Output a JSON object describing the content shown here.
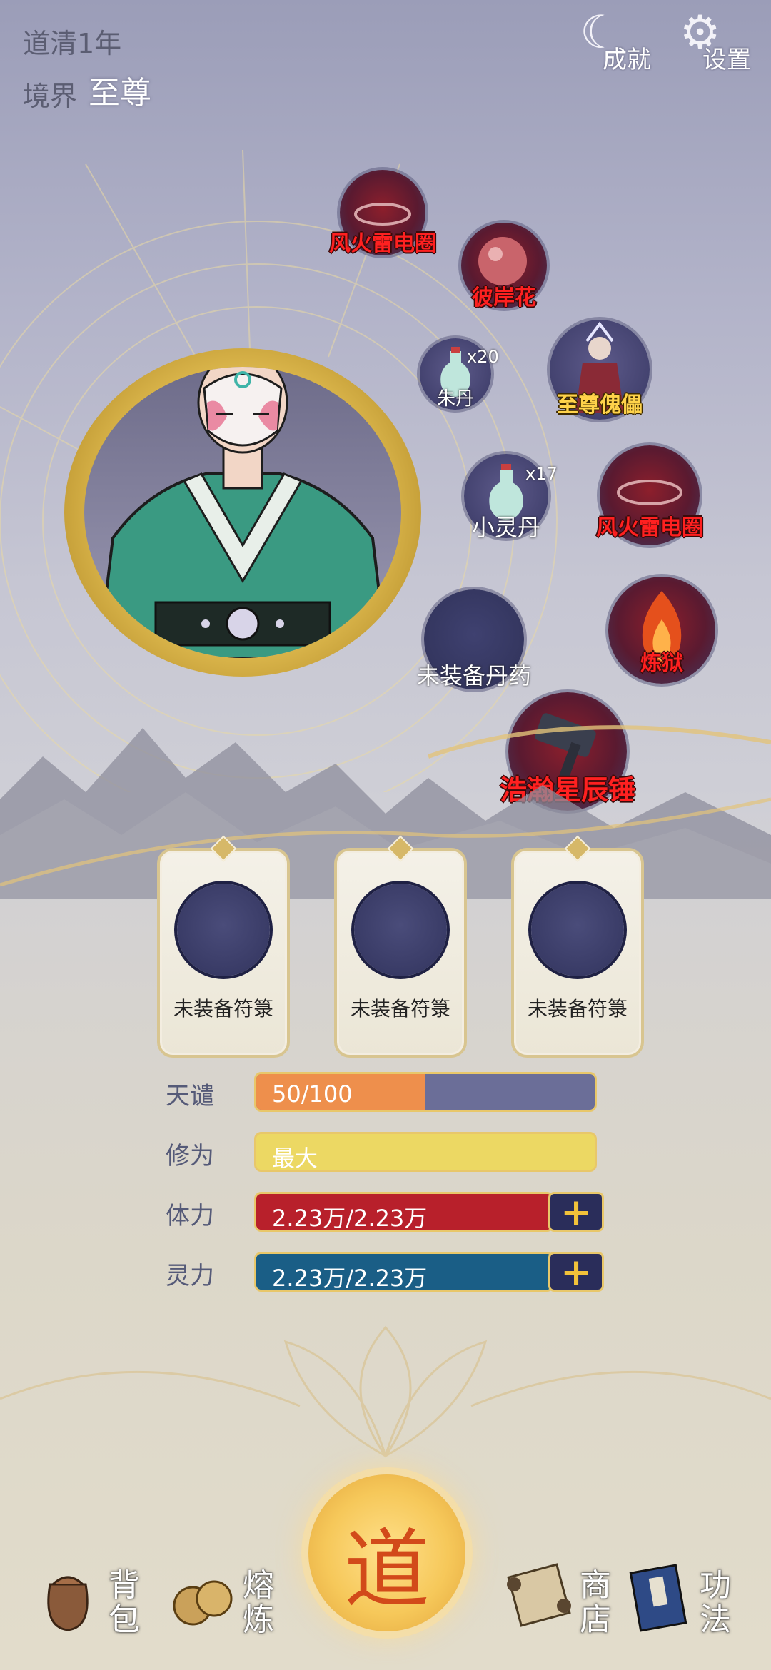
{
  "header": {
    "year": "道清1年",
    "realm_label": "境界",
    "realm_value": "至尊",
    "achievements_label": "成就",
    "settings_label": "设置"
  },
  "equipment": {
    "slots": [
      {
        "label": "风火雷电圈",
        "style": "red"
      },
      {
        "label": "彼岸花",
        "style": "red"
      },
      {
        "label": "朱丹",
        "count": "x20",
        "style": "white"
      },
      {
        "label": "至尊傀儡",
        "style": "gold"
      },
      {
        "label": "小灵丹",
        "count": "x17",
        "style": "white"
      },
      {
        "label": "风火雷电圈",
        "style": "red"
      },
      {
        "label": "未装备丹药",
        "style": "white"
      },
      {
        "label": "炼狱",
        "style": "red"
      },
      {
        "label": "浩瀚星辰锤",
        "style": "red"
      }
    ]
  },
  "talismans": [
    {
      "label": "未装备符箓"
    },
    {
      "label": "未装备符箓"
    },
    {
      "label": "未装备符箓"
    }
  ],
  "stats": {
    "tianqian": {
      "label": "天谴",
      "text": "50/100",
      "fraction": 0.5,
      "color": "#ee8f4c",
      "track": "#6b6e98"
    },
    "xiuwei": {
      "label": "修为",
      "text": "最大",
      "fraction": 1.0,
      "color": "#ecd863",
      "track": "#ecd863"
    },
    "tili": {
      "label": "体力",
      "text": "2.23万/2.23万",
      "fraction": 1.0,
      "color": "#b8202b",
      "track": "#b8202b"
    },
    "lingli": {
      "label": "灵力",
      "text": "2.23万/2.23万",
      "fraction": 1.0,
      "color": "#1a5e86",
      "track": "#1a5e86"
    }
  },
  "nav": {
    "bag": "背包",
    "smelt": "熔炼",
    "dao": "道",
    "shop": "商店",
    "skills": "功法"
  }
}
